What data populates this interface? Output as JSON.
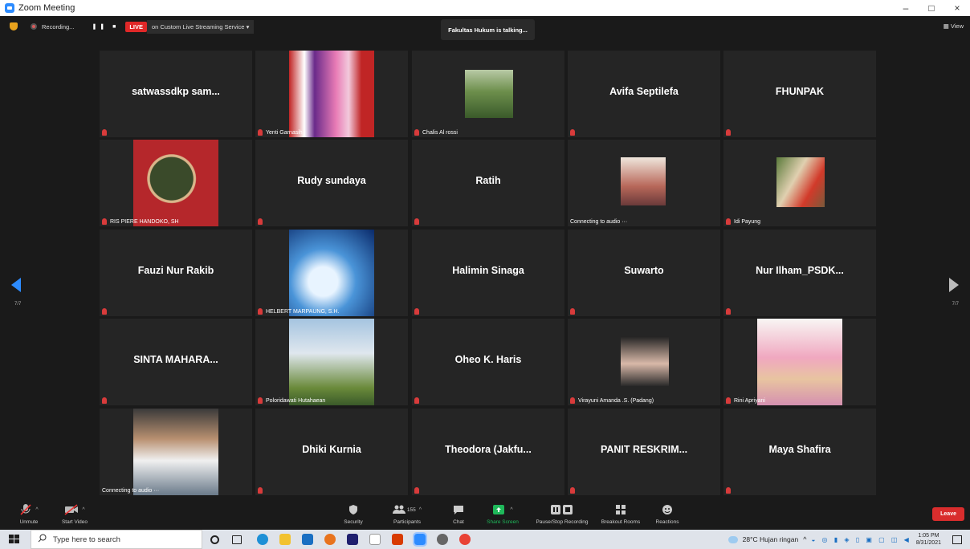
{
  "window": {
    "title": "Zoom Meeting",
    "controls": [
      "–",
      "□",
      "×"
    ]
  },
  "topbar": {
    "recording_label": "Recording...",
    "pause_stop_glyph": "❚❚ ■",
    "live_badge": "LIVE",
    "stream_label": "on Custom Live Streaming Service ▾",
    "talking": "Fakultas Hukum is talking...",
    "view_label": "▦ View"
  },
  "pagination": {
    "left": "7/7",
    "right": "7/7"
  },
  "participants": [
    {
      "name": "satwassdkp sam...",
      "caption": "",
      "video": false
    },
    {
      "name": "",
      "caption": "Yenti Garnasih",
      "video": true
    },
    {
      "name": "",
      "caption": "Chalis Al rossi",
      "video": true
    },
    {
      "name": "Avifa Septilefa",
      "caption": "",
      "video": false
    },
    {
      "name": "FHUNPAK",
      "caption": "",
      "video": false
    },
    {
      "name": "",
      "caption": "RIS PIERE HANDOKO, SH",
      "video": true
    },
    {
      "name": "Rudy sundaya",
      "caption": "",
      "video": false
    },
    {
      "name": "Ratih",
      "caption": "",
      "video": false
    },
    {
      "name": "",
      "caption": "Connecting to audio ···",
      "video": true
    },
    {
      "name": "",
      "caption": "Idi Payung",
      "video": true
    },
    {
      "name": "Fauzi Nur Rakib",
      "caption": "",
      "video": false
    },
    {
      "name": "",
      "caption": "HELBERT MARPAUNG, S.H.",
      "video": true
    },
    {
      "name": "Halimin Sinaga",
      "caption": "",
      "video": false
    },
    {
      "name": "Suwarto",
      "caption": "",
      "video": false
    },
    {
      "name": "Nur  Ilham_PSDK...",
      "caption": "",
      "video": false
    },
    {
      "name": "SINTA  MAHARA...",
      "caption": "",
      "video": false
    },
    {
      "name": "",
      "caption": "Poloridawati Hutahaean",
      "video": true
    },
    {
      "name": "Oheo K. Haris",
      "caption": "",
      "video": false
    },
    {
      "name": "",
      "caption": "Virayuni Amanda .S. (Padang)",
      "video": true
    },
    {
      "name": "",
      "caption": "Rini Apriyani",
      "video": true
    },
    {
      "name": "",
      "caption": "Connecting to audio ···",
      "video": true
    },
    {
      "name": "Dhiki Kurnia",
      "caption": "",
      "video": false
    },
    {
      "name": "Theodora  (Jakfu...",
      "caption": "",
      "video": false
    },
    {
      "name": "PANIT  RESKRIM...",
      "caption": "",
      "video": false
    },
    {
      "name": "Maya Shafira",
      "caption": "",
      "video": false
    }
  ],
  "toolbar": {
    "unmute": "Unmute",
    "start_video": "Start Video",
    "security": "Security",
    "participants": "Participants",
    "participants_count": "155",
    "chat": "Chat",
    "share_screen": "Share Screen",
    "pause_stop_recording": "Pause/Stop Recording",
    "breakout_rooms": "Breakout Rooms",
    "reactions": "Reactions",
    "leave": "Leave"
  },
  "taskbar": {
    "search_placeholder": "Type here to search",
    "weather": "28°C  Hujan ringan",
    "time": "1:05 PM",
    "date": "8/31/2021"
  },
  "colors": {
    "accent": "#2d8cff",
    "live": "#e02828",
    "leave": "#d92d2d",
    "share": "#1fb85a",
    "tile": "#252525",
    "bg": "#1a1a1a"
  }
}
